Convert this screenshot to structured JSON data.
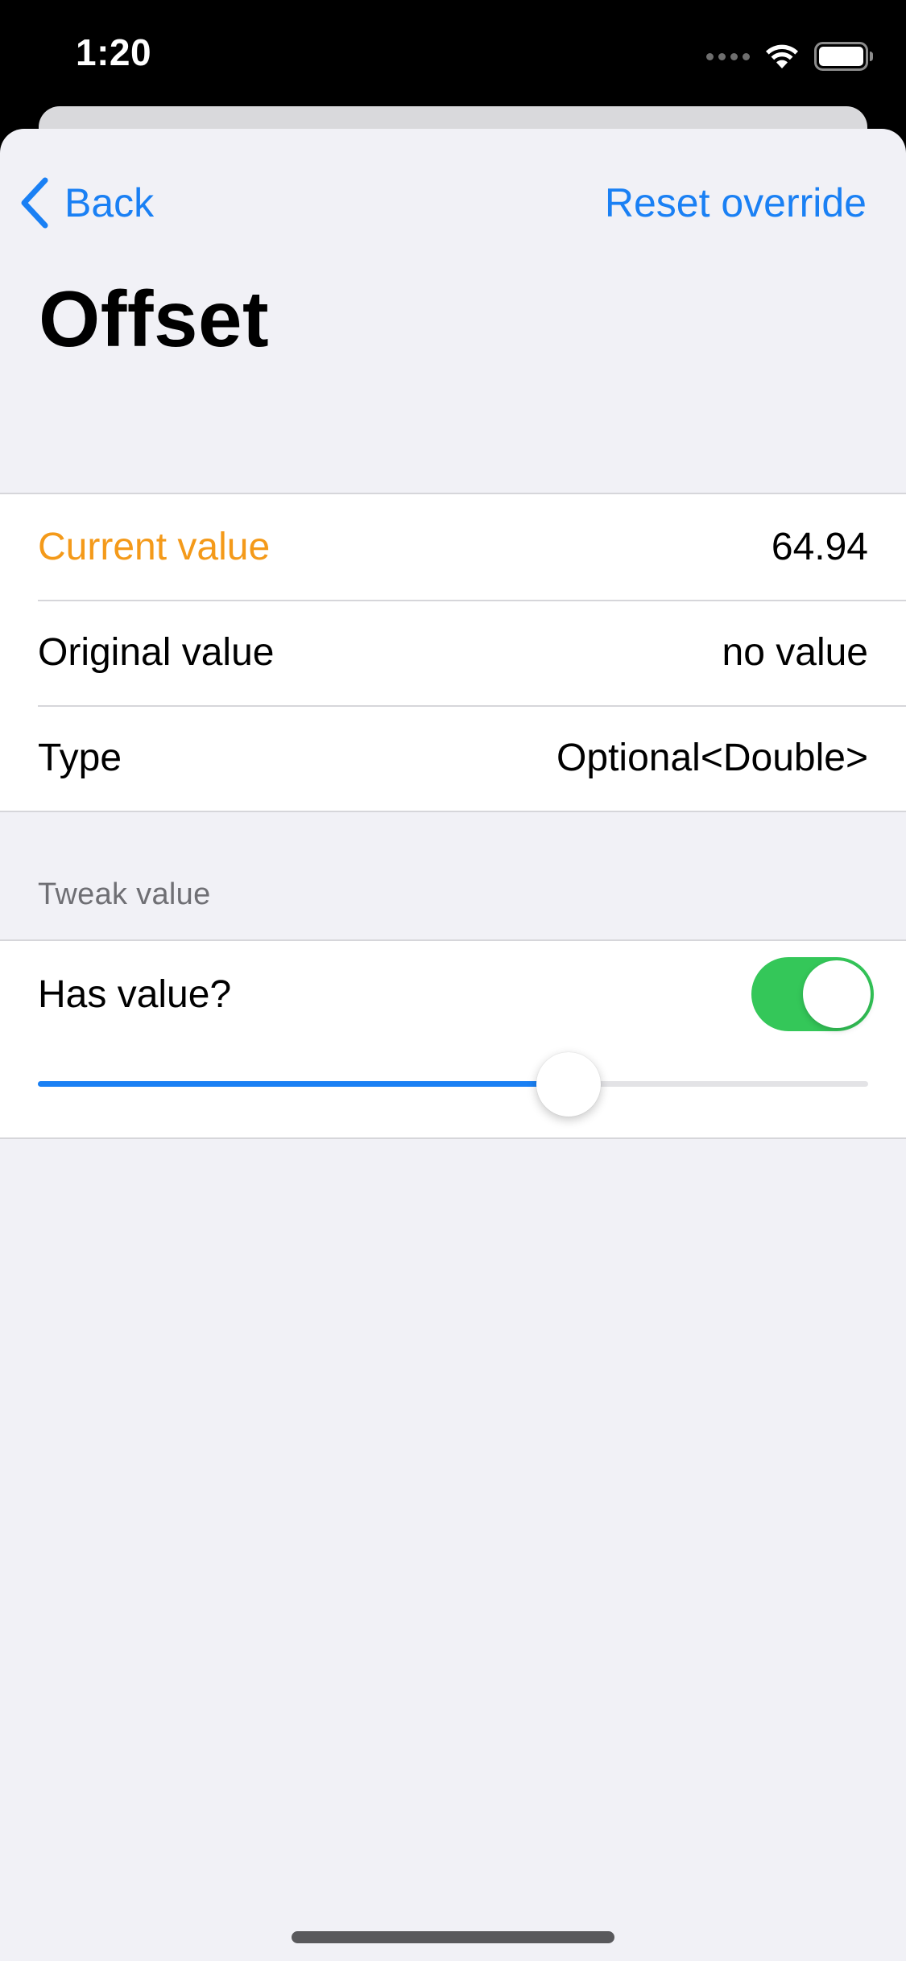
{
  "status_bar": {
    "time": "1:20"
  },
  "nav": {
    "back_label": "Back",
    "reset_label": "Reset override"
  },
  "title": "Offset",
  "info_rows": [
    {
      "label": "Current value",
      "value": "64.94"
    },
    {
      "label": "Original value",
      "value": "no value"
    },
    {
      "label": "Type",
      "value": "Optional<Double>"
    }
  ],
  "tweak_section": {
    "header": "Tweak value",
    "has_value_label": "Has value?",
    "has_value_on": true,
    "slider_fraction": 0.6394
  },
  "colors": {
    "accent_blue": "#1a80f4",
    "current_value_orange": "#f49a1a",
    "toggle_green": "#34c759",
    "background": "#f1f1f6"
  }
}
